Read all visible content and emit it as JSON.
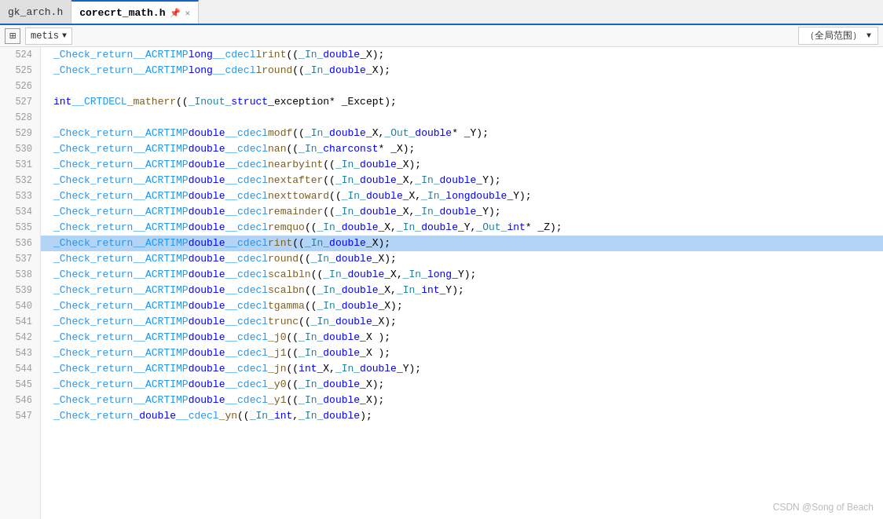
{
  "tabs": [
    {
      "label": "gk_arch.h",
      "active": false,
      "pinned": false,
      "closeable": false
    },
    {
      "label": "corecrt_math.h",
      "active": true,
      "pinned": true,
      "closeable": true
    }
  ],
  "toolbar": {
    "plus_label": "+",
    "metis_label": "metis",
    "scope_label": "（全局范围）"
  },
  "watermark": "CSDN @Song of Beach",
  "lines": [
    {
      "num": "524",
      "content": "_Check_return_ _ACRTIMP long       __cdecl lrint(_In_ double _X);",
      "highlighted": false
    },
    {
      "num": "525",
      "content": "_Check_return_ _ACRTIMP long       __cdecl lround(_In_ double _X);",
      "highlighted": false
    },
    {
      "num": "526",
      "content": "",
      "highlighted": false
    },
    {
      "num": "527",
      "content": "    int __CRTDECL _matherr(_Inout_ struct _exception* _Except);",
      "highlighted": false
    },
    {
      "num": "528",
      "content": "",
      "highlighted": false
    },
    {
      "num": "529",
      "content": "_Check_return_ _ACRTIMP double __cdecl modf(_In_ double _X, _Out_ double* _Y);",
      "highlighted": false
    },
    {
      "num": "530",
      "content": "_Check_return_ _ACRTIMP double __cdecl nan(_In_ char const* _X);",
      "highlighted": false
    },
    {
      "num": "531",
      "content": "_Check_return_ _ACRTIMP double __cdecl nearbyint(_In_ double _X);",
      "highlighted": false
    },
    {
      "num": "532",
      "content": "_Check_return_ _ACRTIMP double __cdecl nextafter(_In_ double _X, _In_ double _Y);",
      "highlighted": false
    },
    {
      "num": "533",
      "content": "_Check_return_ _ACRTIMP double __cdecl nexttoward(_In_ double _X, _In_ long double _Y);",
      "highlighted": false
    },
    {
      "num": "534",
      "content": "_Check_return_ _ACRTIMP double __cdecl remainder(_In_ double _X, _In_ double _Y);",
      "highlighted": false
    },
    {
      "num": "535",
      "content": "_Check_return_ _ACRTIMP double __cdecl remquo(_In_ double _X, _In_ double _Y, _Out_ int* _Z);",
      "highlighted": false
    },
    {
      "num": "536",
      "content": "_Check_return_ _ACRTIMP double __cdecl rint(_In_ double _X);",
      "highlighted": true
    },
    {
      "num": "537",
      "content": "_Check_return_ _ACRTIMP double __cdecl round(_In_ double _X);",
      "highlighted": false
    },
    {
      "num": "538",
      "content": "_Check_return_ _ACRTIMP double __cdecl scalbln(_In_ double _X, _In_ long _Y);",
      "highlighted": false
    },
    {
      "num": "539",
      "content": "_Check_return_ _ACRTIMP double __cdecl scalbn(_In_ double _X, _In_ int _Y);",
      "highlighted": false
    },
    {
      "num": "540",
      "content": "_Check_return_ _ACRTIMP double __cdecl tgamma(_In_ double _X);",
      "highlighted": false
    },
    {
      "num": "541",
      "content": "_Check_return_ _ACRTIMP double __cdecl trunc(_In_ double _X);",
      "highlighted": false
    },
    {
      "num": "542",
      "content": "_Check_return_ _ACRTIMP double __cdecl _j0(_In_ double _X );",
      "highlighted": false
    },
    {
      "num": "543",
      "content": "_Check_return_ _ACRTIMP double __cdecl _j1(_In_ double _X );",
      "highlighted": false
    },
    {
      "num": "544",
      "content": "_Check_return_ _ACRTIMP double __cdecl _jn(int _X, _In_ double _Y);",
      "highlighted": false
    },
    {
      "num": "545",
      "content": "_Check_return_ _ACRTIMP double __cdecl _y0(_In_ double _X);",
      "highlighted": false
    },
    {
      "num": "546",
      "content": "_Check_return_ _ACRTIMP double __cdecl _y1(_In_ double _X);",
      "highlighted": false
    },
    {
      "num": "547",
      "content": "    _Check_return_ double __cdecl _yn(_In_ int, _In_ double);",
      "highlighted": false
    }
  ]
}
